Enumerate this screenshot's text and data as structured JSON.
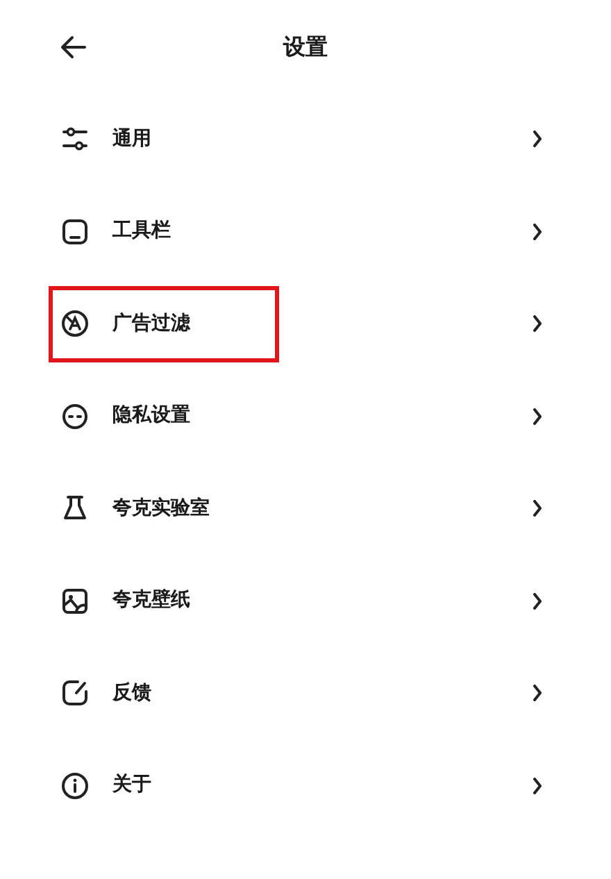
{
  "header": {
    "title": "设置"
  },
  "items": [
    {
      "label": "通用",
      "highlighted": false
    },
    {
      "label": "工具栏",
      "highlighted": false
    },
    {
      "label": "广告过滤",
      "highlighted": true
    },
    {
      "label": "隐私设置",
      "highlighted": false
    },
    {
      "label": "夸克实验室",
      "highlighted": false
    },
    {
      "label": "夸克壁纸",
      "highlighted": false
    },
    {
      "label": "反馈",
      "highlighted": false
    },
    {
      "label": "关于",
      "highlighted": false
    }
  ]
}
